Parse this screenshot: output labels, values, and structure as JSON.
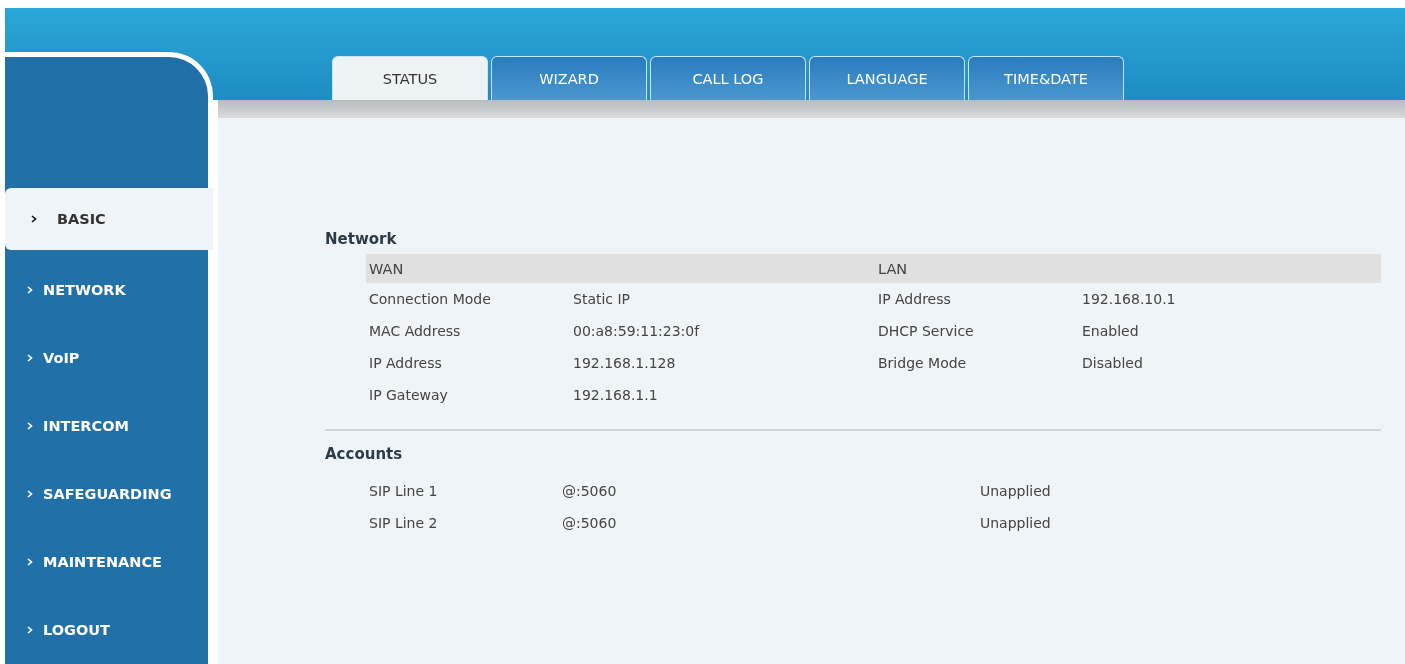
{
  "tabs": [
    {
      "label": "STATUS",
      "selected": true
    },
    {
      "label": "WIZARD",
      "selected": false
    },
    {
      "label": "CALL LOG",
      "selected": false
    },
    {
      "label": "LANGUAGE",
      "selected": false
    },
    {
      "label": "TIME&DATE",
      "selected": false
    }
  ],
  "sidebar": {
    "items": [
      {
        "label": "BASIC",
        "selected": true
      },
      {
        "label": "NETWORK",
        "selected": false
      },
      {
        "label": "VoIP",
        "selected": false
      },
      {
        "label": "INTERCOM",
        "selected": false
      },
      {
        "label": "SAFEGUARDING",
        "selected": false
      },
      {
        "label": "MAINTENANCE",
        "selected": false
      },
      {
        "label": "LOGOUT",
        "selected": false
      }
    ]
  },
  "network": {
    "title": "Network",
    "wan": {
      "header": "WAN",
      "rows": [
        {
          "label": "Connection Mode",
          "value": "Static IP"
        },
        {
          "label": "MAC Address",
          "value": "00:a8:59:11:23:0f"
        },
        {
          "label": "IP Address",
          "value": "192.168.1.128"
        },
        {
          "label": "IP Gateway",
          "value": "192.168.1.1"
        }
      ]
    },
    "lan": {
      "header": "LAN",
      "rows": [
        {
          "label": "IP Address",
          "value": "192.168.10.1"
        },
        {
          "label": "DHCP Service",
          "value": "Enabled"
        },
        {
          "label": "Bridge Mode",
          "value": "Disabled"
        }
      ]
    }
  },
  "accounts": {
    "title": "Accounts",
    "rows": [
      {
        "line": "SIP Line 1",
        "address": "@:5060",
        "status": "Unapplied"
      },
      {
        "line": "SIP Line 2",
        "address": "@:5060",
        "status": "Unapplied"
      }
    ]
  }
}
